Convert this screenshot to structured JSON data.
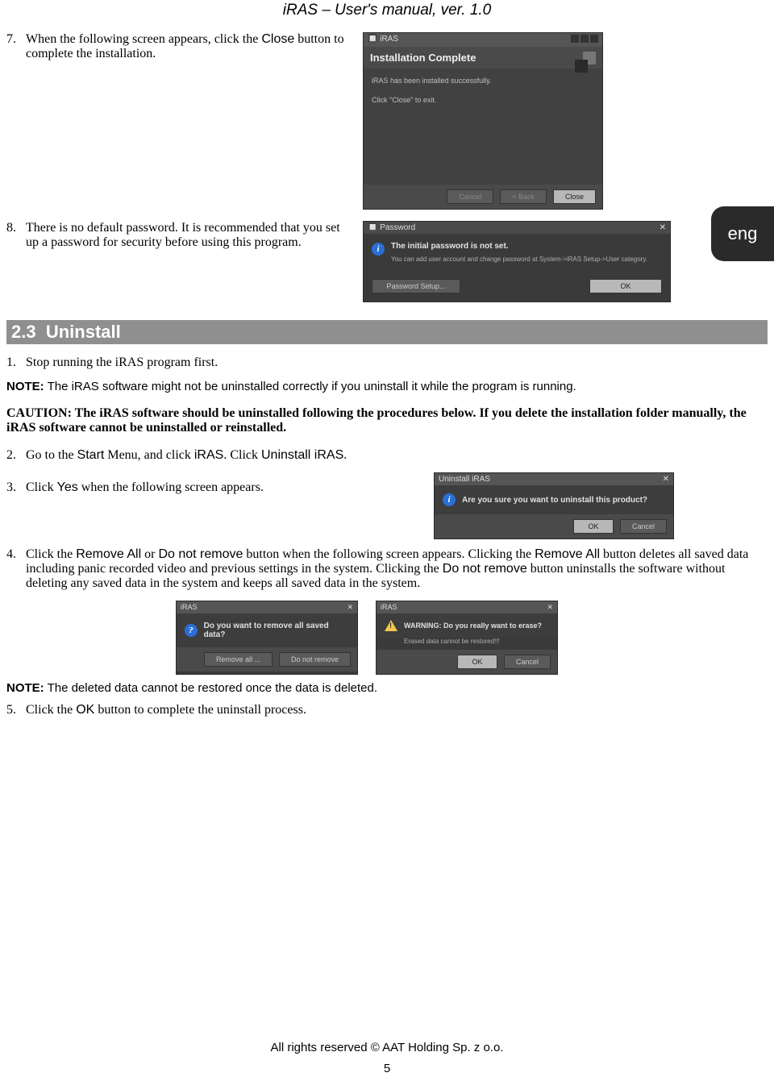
{
  "header": {
    "title": "iRAS – User's manual, ver. 1.0"
  },
  "eng_tab": "eng",
  "step7": {
    "num": "7.",
    "text_a": "When the following screen appears, click the ",
    "close_word": "Close",
    "text_b": " button to complete the installation."
  },
  "install_dialog": {
    "titlebar_app": "iRAS",
    "title": "Installation Complete",
    "line1": "iRAS has been installed successfully.",
    "line2": "Click \"Close\" to exit.",
    "btn_cancel": "Cancel",
    "btn_back": "< Back",
    "btn_close": "Close"
  },
  "step8": {
    "num": "8.",
    "text": "There is no default password.  It is recommended that you set up a password for security before using this program."
  },
  "pw_dialog": {
    "titlebar": "Password",
    "line1": "The initial password is not set.",
    "line2": "You can add user account and change password at System->iRAS Setup->User category.",
    "btn_setup": "Password Setup...",
    "btn_ok": "OK"
  },
  "section": {
    "num": "2.3",
    "title": "Uninstall"
  },
  "u_step1": {
    "num": "1.",
    "text": "Stop running the iRAS program first."
  },
  "note1": {
    "label": "NOTE:",
    "text": " The iRAS software might not be uninstalled correctly if you uninstall it while the program is running."
  },
  "caution": {
    "text": "CAUTION: The iRAS software should be uninstalled following the procedures below.  If you delete the installation folder manually, the iRAS software cannot be uninstalled or reinstalled."
  },
  "u_step2": {
    "num": "2.",
    "a": "Go to the ",
    "start": "Start",
    "b": " Menu, and click ",
    "iras": "iRAS",
    "c": ".  Click ",
    "uninstall": "Uninstall iRAS",
    "d": "."
  },
  "u_step3": {
    "num": "3.",
    "a": "Click ",
    "yes": "Yes",
    "b": " when the following screen appears."
  },
  "confirm_dialog": {
    "titlebar": "Uninstall iRAS",
    "msg": "Are you sure you want to uninstall this product?",
    "btn_ok": "OK",
    "btn_cancel": "Cancel"
  },
  "u_step4": {
    "num": "4.",
    "a": "Click the ",
    "remove_all": "Remove All",
    "b": " or ",
    "do_not": "Do not remove",
    "c": " button when the following screen appears.  Clicking the ",
    "remove_all2": "Remove All",
    "d": " button deletes all saved data including panic recorded video and previous settings in the system.  Clicking the ",
    "do_not2": "Do not remove",
    "e": " button uninstalls the software without deleting any saved data in the system and keeps all saved data in the system."
  },
  "remove_dialog": {
    "titlebar": "iRAS",
    "msg": "Do you want to remove all saved data?",
    "btn_remove": "Remove all ...",
    "btn_dont": "Do not remove"
  },
  "erase_dialog": {
    "titlebar": "iRAS",
    "msg": "WARNING: Do you really want to erase?",
    "sub": "Erased data cannot be restored!!!",
    "btn_ok": "OK",
    "btn_cancel": "Cancel"
  },
  "note2": {
    "label": "NOTE:",
    "text": " The deleted data cannot be restored once the data is deleted."
  },
  "u_step5": {
    "num": "5.",
    "a": "Click the ",
    "ok": "OK",
    "b": " button to complete the uninstall process."
  },
  "footer": "All rights reserved © AAT Holding Sp. z o.o.",
  "page_num": "5"
}
